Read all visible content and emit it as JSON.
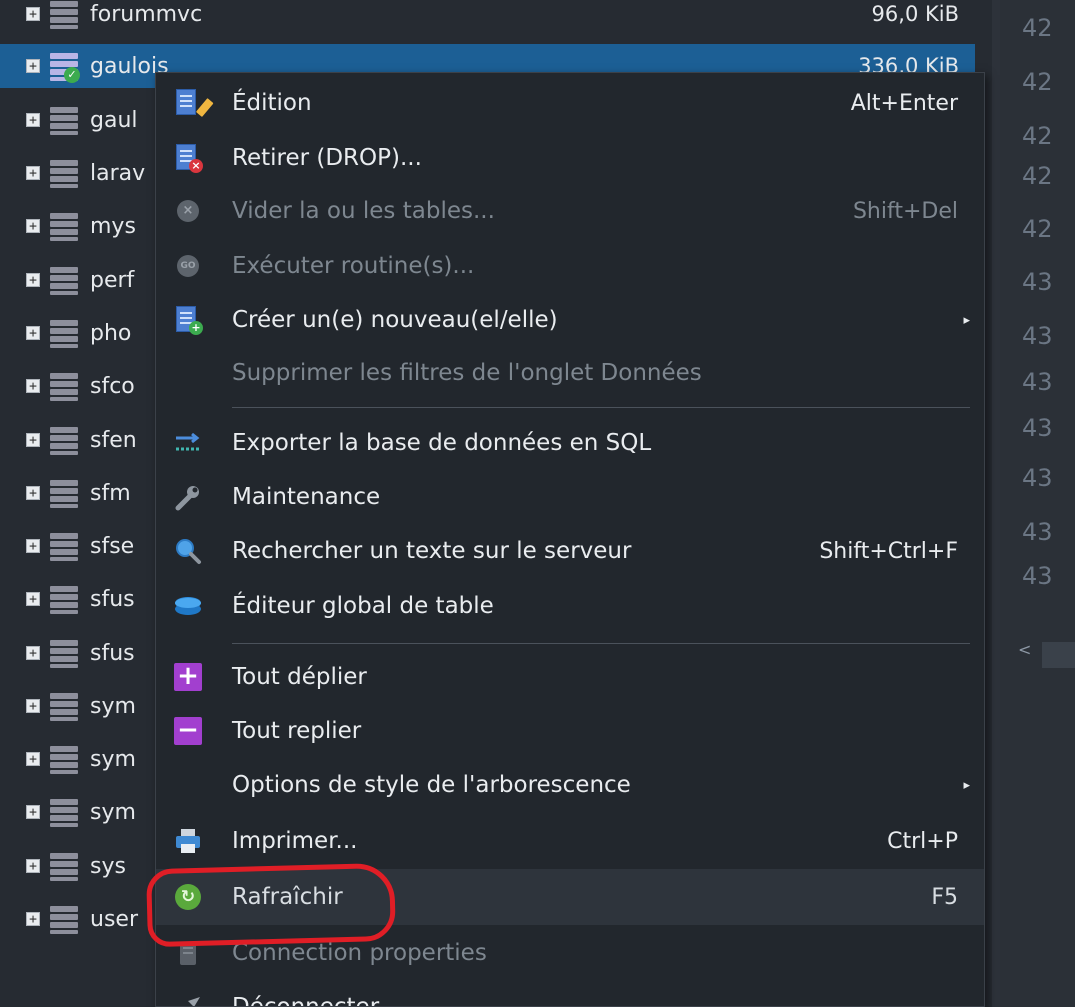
{
  "tree": {
    "items": [
      {
        "name": "forummvc",
        "size": "96,0 KiB"
      },
      {
        "name": "gaulois",
        "size": "336,0 KiB",
        "selected": true
      },
      {
        "name": "gaul"
      },
      {
        "name": "larav"
      },
      {
        "name": "mys"
      },
      {
        "name": "perf"
      },
      {
        "name": "pho"
      },
      {
        "name": "sfco"
      },
      {
        "name": "sfen"
      },
      {
        "name": "sfm"
      },
      {
        "name": "sfse"
      },
      {
        "name": "sfus"
      },
      {
        "name": "sfus"
      },
      {
        "name": "sym"
      },
      {
        "name": "sym"
      },
      {
        "name": "sym"
      },
      {
        "name": "sys"
      },
      {
        "name": "user"
      }
    ],
    "expander_symbol": "+"
  },
  "right_column": {
    "numbers": [
      "42",
      "42",
      "42",
      "42",
      "42",
      "43",
      "43",
      "43",
      "43",
      "43",
      "43",
      "43"
    ],
    "scroll_left_symbol": "<"
  },
  "context_menu": {
    "items": [
      {
        "label": "Édition",
        "shortcut": "Alt+Enter",
        "icon": "edit-icon"
      },
      {
        "label": "Retirer (DROP)...",
        "icon": "drop-icon"
      },
      {
        "label": "Vider la ou les tables...",
        "shortcut": "Shift+Del",
        "icon": "empty-tables-icon",
        "disabled": true
      },
      {
        "label": "Exécuter routine(s)...",
        "icon": "run-routine-icon",
        "disabled": true
      },
      {
        "label": "Créer un(e) nouveau(el/elle)",
        "icon": "create-new-icon",
        "submenu": true
      },
      {
        "label": "Supprimer les filtres de l'onglet Données",
        "disabled": true
      },
      {
        "label": "Exporter la base de données en SQL",
        "icon": "export-sql-icon"
      },
      {
        "label": "Maintenance",
        "icon": "wrench-icon"
      },
      {
        "label": "Rechercher un texte sur le serveur",
        "shortcut": "Shift+Ctrl+F",
        "icon": "search-icon"
      },
      {
        "label": "Éditeur global de table",
        "icon": "bulk-table-editor-icon"
      },
      {
        "label": "Tout déplier",
        "icon": "expand-all-icon"
      },
      {
        "label": "Tout replier",
        "icon": "collapse-all-icon"
      },
      {
        "label": "Options de style de l'arborescence",
        "submenu": true
      },
      {
        "label": "Imprimer...",
        "shortcut": "Ctrl+P",
        "icon": "printer-icon"
      },
      {
        "label": "Rafraîchir",
        "shortcut": "F5",
        "icon": "refresh-icon"
      },
      {
        "label": "Connection properties",
        "icon": "connection-properties-icon",
        "disabled": true
      },
      {
        "label": "Déconnecter",
        "icon": "disconnect-icon"
      }
    ],
    "glyphs": {
      "submenu_arrow": "▸",
      "drop_badge": "×",
      "empty_tables": "×",
      "run_routine": "GO",
      "create_badge": "+",
      "plus": "+",
      "minus": "−",
      "refresh": "↻",
      "check": "✓"
    }
  },
  "colors": {
    "selection": "#1c5f95",
    "menu_background": "#22272d",
    "annotation": "#e01e26"
  }
}
